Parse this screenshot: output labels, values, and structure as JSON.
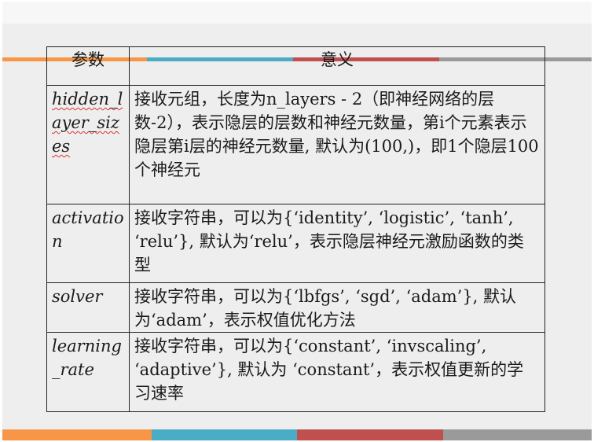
{
  "table": {
    "headers": [
      "参数",
      "意义"
    ],
    "rows": [
      {
        "name": "hidden_layer_sizes",
        "meaning": "接收元组，长度为n_layers - 2（即神经网络的层数-2），表示隐层的层数和神经元数量，第i个元素表示隐层第i层的神经元数量, 默认为(100,)，即1个隐层100个神经元"
      },
      {
        "name": "activation",
        "meaning": "接收字符串，可以为{‘identity’, ‘logistic’, ‘tanh’, ‘relu’}, 默认为‘relu’，表示隐层神经元激励函数的类型"
      },
      {
        "name": "solver",
        "meaning": "接收字符串，可以为{‘lbfgs’, ‘sgd’, ‘adam’}, 默认为‘adam’，表示权值优化方法"
      },
      {
        "name": "learning_rate",
        "meaning": "接收字符串，可以为{‘constant’, ‘invscaling’, ‘adaptive’}, 默认为 ‘constant’，表示权值更新的学习速率"
      }
    ]
  },
  "colors": {
    "orange": "#f79646",
    "blue": "#4bacc6",
    "red": "#c0504d",
    "gray": "#9a9a9a"
  }
}
